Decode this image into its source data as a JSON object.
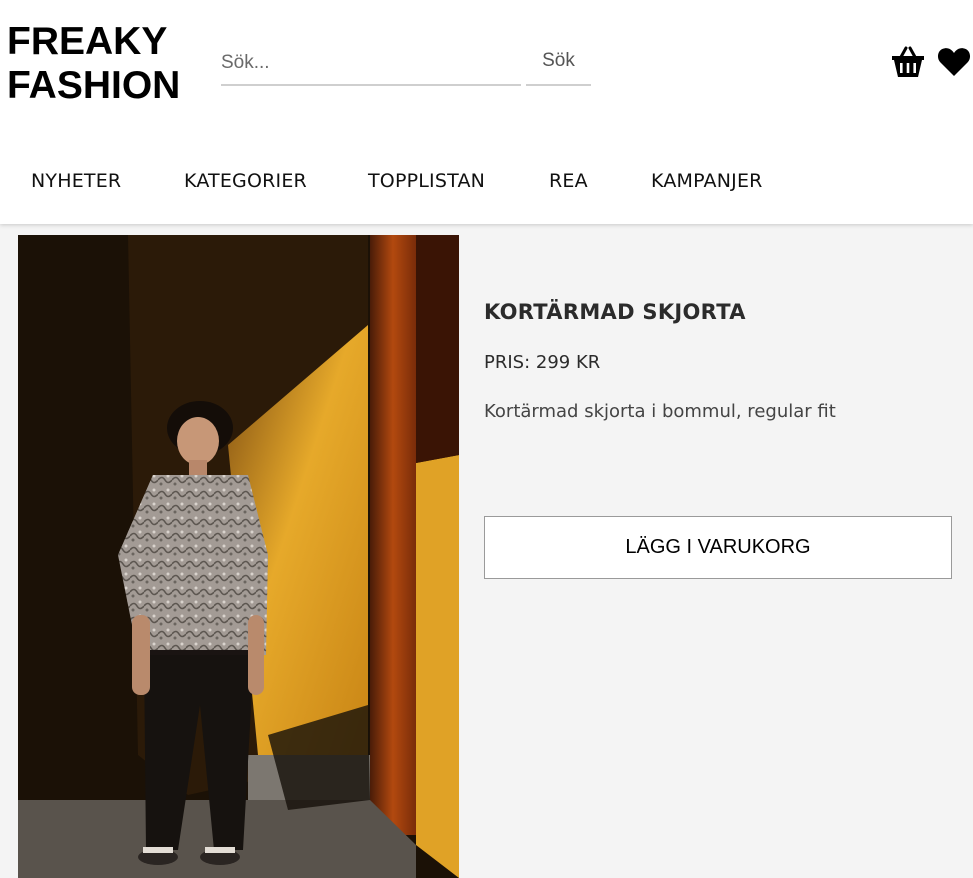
{
  "header": {
    "logo_line1": "FREAKY",
    "logo_line2": "FASHION",
    "search_placeholder": "Sök...",
    "search_button": "Sök",
    "icons": [
      "basket-icon",
      "heart-icon"
    ]
  },
  "nav": {
    "items": [
      {
        "label": "NYHETER"
      },
      {
        "label": "KATEGORIER"
      },
      {
        "label": "TOPPLISTAN"
      },
      {
        "label": "REA"
      },
      {
        "label": "KAMPANJER"
      }
    ]
  },
  "product": {
    "title": "KORTÄRMAD SKJORTA",
    "price": "PRIS: 299 KR",
    "description": "Kortärmad skjorta i bommul, regular fit",
    "add_to_cart": "LÄGG I VARUKORG"
  },
  "colors": {
    "header_bg": "#ffffff",
    "page_bg": "#f4f4f4",
    "text": "#2b2b2b"
  }
}
